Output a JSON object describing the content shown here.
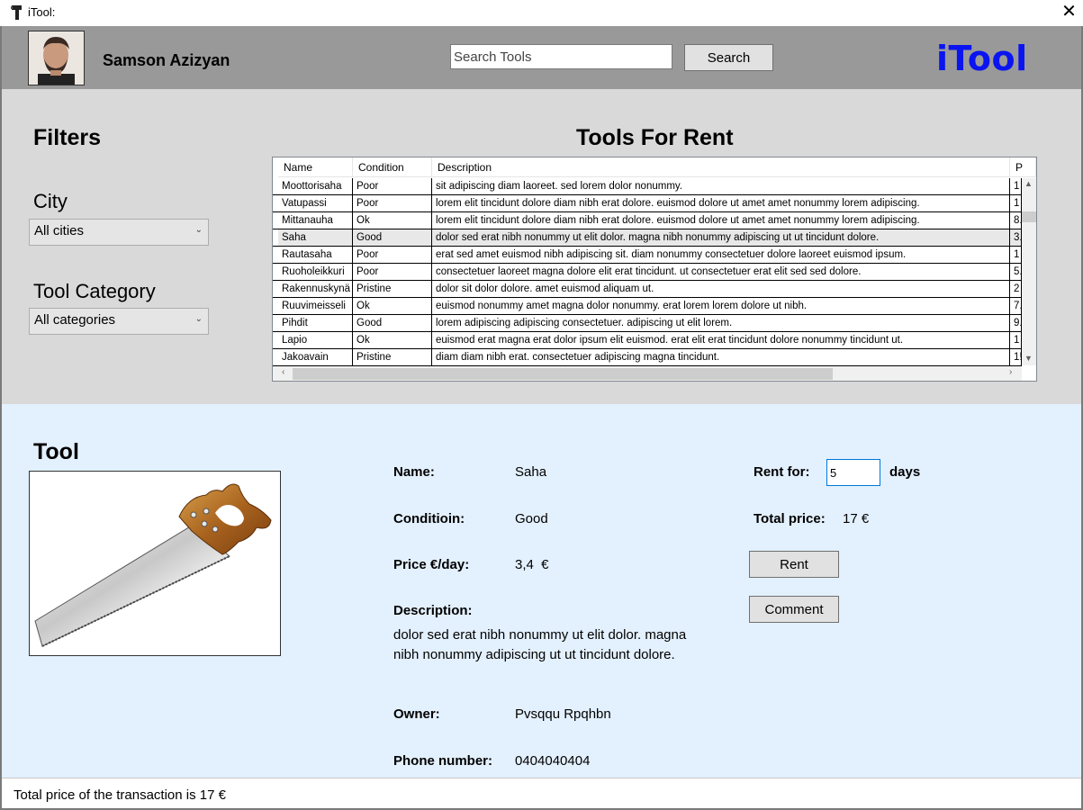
{
  "window": {
    "title": "iTool:",
    "close_glyph": "✕"
  },
  "header": {
    "user_name": "Samson Azizyan",
    "search_placeholder": "Search Tools",
    "search_button": "Search",
    "logo": "iTool"
  },
  "filters": {
    "heading": "Filters",
    "city_label": "City",
    "city_selected": "All cities",
    "category_label": "Tool Category",
    "category_selected": "All categories"
  },
  "tools_table": {
    "heading": "Tools For Rent",
    "columns": [
      "Name",
      "Condition",
      "Description",
      "P"
    ],
    "rows": [
      {
        "name": "Moottorisaha",
        "condition": "Poor",
        "description": "sit adipiscing diam laoreet. sed lorem dolor nonummy.",
        "price": "1"
      },
      {
        "name": "Vatupassi",
        "condition": "Poor",
        "description": "lorem elit tincidunt dolore diam nibh erat dolore. euismod dolore ut amet amet nonummy lorem adipiscing.",
        "price": "1"
      },
      {
        "name": "Mittanauha",
        "condition": "Ok",
        "description": "lorem elit tincidunt dolore diam nibh erat dolore. euismod dolore ut amet amet nonummy lorem adipiscing.",
        "price": "8."
      },
      {
        "name": "Saha",
        "condition": "Good",
        "description": "dolor sed erat nibh nonummy ut elit dolor. magna nibh nonummy adipiscing ut ut tincidunt dolore.",
        "price": "3."
      },
      {
        "name": "Rautasaha",
        "condition": "Poor",
        "description": "erat sed amet euismod nibh adipiscing sit. diam nonummy consectetuer dolore laoreet euismod ipsum.",
        "price": "1"
      },
      {
        "name": "Ruoholeikkuri",
        "condition": "Poor",
        "description": "consectetuer laoreet magna dolore elit erat tincidunt. ut consectetuer erat elit sed sed dolore.",
        "price": "5."
      },
      {
        "name": "Rakennuskynä",
        "condition": "Pristine",
        "description": "dolor sit dolor dolore. amet euismod aliquam ut.",
        "price": "2"
      },
      {
        "name": "Ruuvimeisseli",
        "condition": "Ok",
        "description": "euismod nonummy amet magna dolor nonummy. erat lorem lorem dolore ut nibh.",
        "price": "7."
      },
      {
        "name": "Pihdit",
        "condition": "Good",
        "description": "lorem adipiscing adipiscing consectetuer. adipiscing ut elit lorem.",
        "price": "9."
      },
      {
        "name": "Lapio",
        "condition": "Ok",
        "description": "euismod erat magna erat dolor ipsum elit euismod. erat elit erat tincidunt dolore nonummy tincidunt ut.",
        "price": "1"
      },
      {
        "name": "Jakoavain",
        "condition": "Pristine",
        "description": "diam diam nibh erat. consectetuer adipiscing magna tincidunt.",
        "price": "1!"
      }
    ],
    "selected_row": 3
  },
  "tool_detail": {
    "heading": "Tool",
    "name_label": "Name:",
    "name_value": "Saha",
    "condition_label": "Conditioin:",
    "condition_value": "Good",
    "price_label": "Price €/day:",
    "price_value": "3,4  €",
    "description_label": "Description:",
    "description_value": "dolor sed erat nibh nonummy ut elit dolor. magna nibh nonummy adipiscing ut ut tincidunt dolore.",
    "owner_label": "Owner:",
    "owner_value": "Pvsqqu Rpqhbn",
    "phone_label": "Phone number:",
    "phone_value": "0404040404"
  },
  "rent": {
    "rent_for_label": "Rent for:",
    "days_value": "5",
    "days_label": "days",
    "total_label": "Total price:",
    "total_value": "17 €",
    "rent_button": "Rent",
    "comment_button": "Comment"
  },
  "status": {
    "text": "Total price of the transaction is 17 €"
  },
  "colors": {
    "logo": "#0a14f0",
    "header_bg": "#999999",
    "filters_bg": "#d9d9d9",
    "detail_bg": "#e3f0fd"
  }
}
